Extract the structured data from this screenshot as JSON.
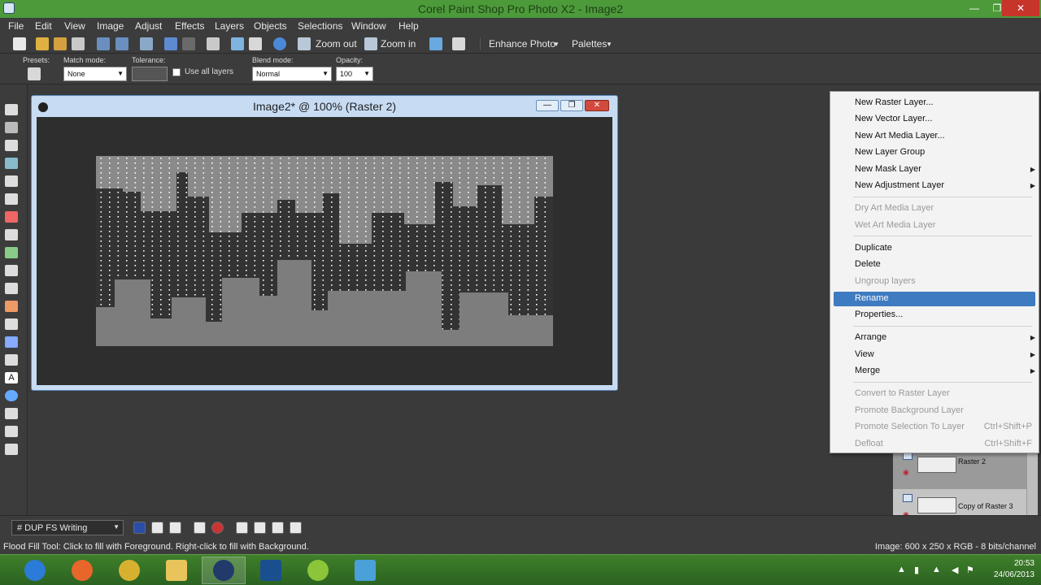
{
  "window": {
    "title": "Corel Paint Shop Pro Photo X2 - Image2"
  },
  "menu": [
    "File",
    "Edit",
    "View",
    "Image",
    "Adjust",
    "Effects",
    "Layers",
    "Objects",
    "Selections",
    "Window",
    "Help"
  ],
  "toolbar": {
    "zoom_out": "Zoom out",
    "zoom_in": "Zoom in",
    "enhance": "Enhance Photo",
    "palettes": "Palettes"
  },
  "options": {
    "presets_label": "Presets:",
    "match_label": "Match mode:",
    "match_value": "None",
    "tolerance_label": "Tolerance:",
    "use_all_layers": "Use all layers",
    "blend_label": "Blend mode:",
    "blend_value": "Normal",
    "opacity_label": "Opacity:",
    "opacity_value": "100"
  },
  "image_window": {
    "title": "Image2* @ 100% (Raster 2)"
  },
  "context_menu": {
    "items": [
      {
        "label": "New Raster Layer...",
        "enabled": true
      },
      {
        "label": "New Vector Layer...",
        "enabled": true
      },
      {
        "label": "New Art Media Layer...",
        "enabled": true
      },
      {
        "label": "New Layer Group",
        "enabled": true
      },
      {
        "label": "New Mask Layer",
        "enabled": true,
        "submenu": true
      },
      {
        "label": "New Adjustment Layer",
        "enabled": true,
        "submenu": true
      },
      {
        "label": "Dry Art Media Layer",
        "enabled": false
      },
      {
        "label": "Wet Art Media Layer",
        "enabled": false
      },
      {
        "label": "Duplicate",
        "enabled": true
      },
      {
        "label": "Delete",
        "enabled": true
      },
      {
        "label": "Ungroup layers",
        "enabled": false
      },
      {
        "label": "Rename",
        "enabled": true,
        "highlighted": true
      },
      {
        "label": "Properties...",
        "enabled": true
      },
      {
        "label": "Arrange",
        "enabled": true,
        "submenu": true
      },
      {
        "label": "View",
        "enabled": true,
        "submenu": true
      },
      {
        "label": "Merge",
        "enabled": true,
        "submenu": true
      },
      {
        "label": "Convert to Raster Layer",
        "enabled": false
      },
      {
        "label": "Promote Background Layer",
        "enabled": false
      },
      {
        "label": "Promote Selection To Layer",
        "enabled": false,
        "shortcut": "Ctrl+Shift+P"
      },
      {
        "label": "Defloat",
        "enabled": false,
        "shortcut": "Ctrl+Shift+F"
      }
    ]
  },
  "layers": [
    {
      "name": "Raster 2",
      "selected": true
    },
    {
      "name": "Copy of Raster 3",
      "selected": false
    }
  ],
  "script": {
    "name": "# DUP FS Writing"
  },
  "status": {
    "left": "Flood Fill Tool: Click to fill with Foreground. Right-click to fill with Background.",
    "right": "Image:  600 x 250 x RGB - 8 bits/channel"
  },
  "taskbar": {
    "time": "20:53",
    "date": "24/06/2013"
  }
}
